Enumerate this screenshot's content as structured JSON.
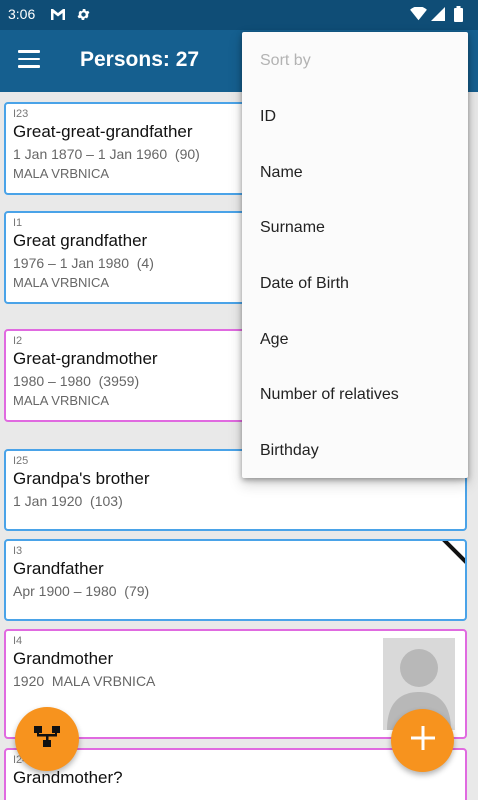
{
  "status_bar": {
    "time": "3:06",
    "icons": [
      "gmail-icon",
      "settings-gear-icon",
      "wifi-icon",
      "signal-icon",
      "battery-icon"
    ]
  },
  "app_bar": {
    "title": "Persons: 27",
    "menu_icon": "hamburger-menu-icon",
    "background": "#155f8f",
    "status_background": "#0f4d76"
  },
  "persons": [
    {
      "id": "I23",
      "name": "Great-great-grandfather",
      "dates": "1 Jan 1870 – 1 Jan 1960  (90)",
      "place": "MALA VRBNICA",
      "gender": "male"
    },
    {
      "id": "I1",
      "name": "Great grandfather",
      "dates": "1976 – 1 Jan 1980  (4)",
      "place": "MALA VRBNICA",
      "gender": "male"
    },
    {
      "id": "I2",
      "name": "Great-grandmother",
      "dates": "1980 – 1980  (3959)",
      "place": "MALA VRBNICA",
      "gender": "female"
    },
    {
      "id": "I25",
      "name": "Grandpa's brother",
      "dates": "1 Jan 1920  (103)",
      "place": "",
      "gender": "male"
    },
    {
      "id": "I3",
      "name": "Grandfather",
      "dates": "Apr 1900 – 1980  (79)",
      "place": "",
      "gender": "male",
      "deceased_marker": true
    },
    {
      "id": "I4",
      "name": "Grandmother",
      "dates": "1920  MALA VRBNICA",
      "place": "",
      "gender": "female",
      "has_photo": true
    },
    {
      "id": "I24",
      "name": "Grandmother?",
      "dates": "",
      "place": "",
      "gender": "female"
    }
  ],
  "sort_menu": {
    "header": "Sort by",
    "options": [
      "ID",
      "Name",
      "Surname",
      "Date of Birth",
      "Age",
      "Number of relatives",
      "Birthday"
    ]
  },
  "fabs": {
    "tree_icon": "family-tree-icon",
    "add_icon": "plus-icon",
    "color": "#f7931e"
  },
  "colors": {
    "male_border": "#4aa3e8",
    "female_border": "#e06ae0"
  }
}
